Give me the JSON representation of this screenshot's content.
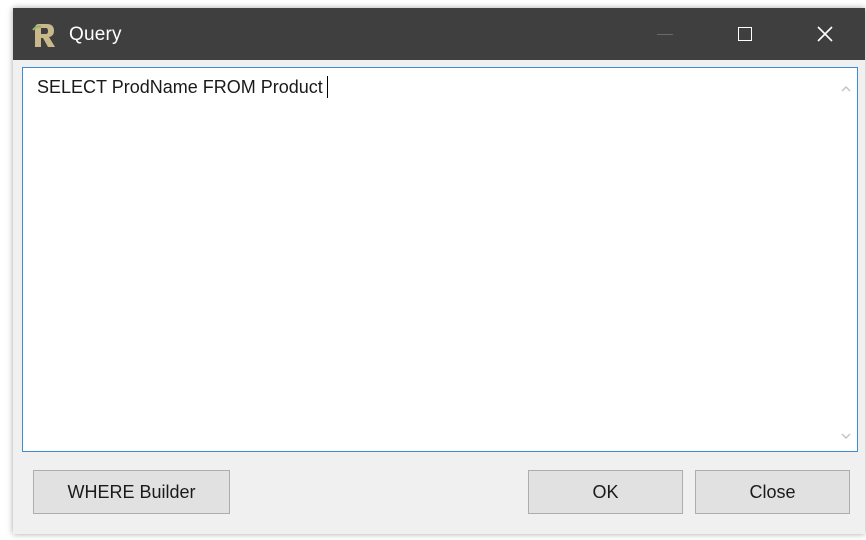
{
  "window": {
    "title": "Query",
    "icon": "app-r-icon",
    "controls": {
      "minimize_icon": "minimize-icon",
      "maximize_icon": "maximize-icon",
      "close_icon": "close-icon",
      "close_glyph": "✕"
    }
  },
  "editor": {
    "text": "SELECT ProdName FROM Product"
  },
  "buttons": {
    "where_builder": "WHERE Builder",
    "ok": "OK",
    "close": "Close"
  },
  "colors": {
    "titlebar": "#3f3f3f",
    "accent_border": "#3c8ad8",
    "button_face": "#e1e1e1",
    "dialog_bg": "#f0f0f0"
  }
}
